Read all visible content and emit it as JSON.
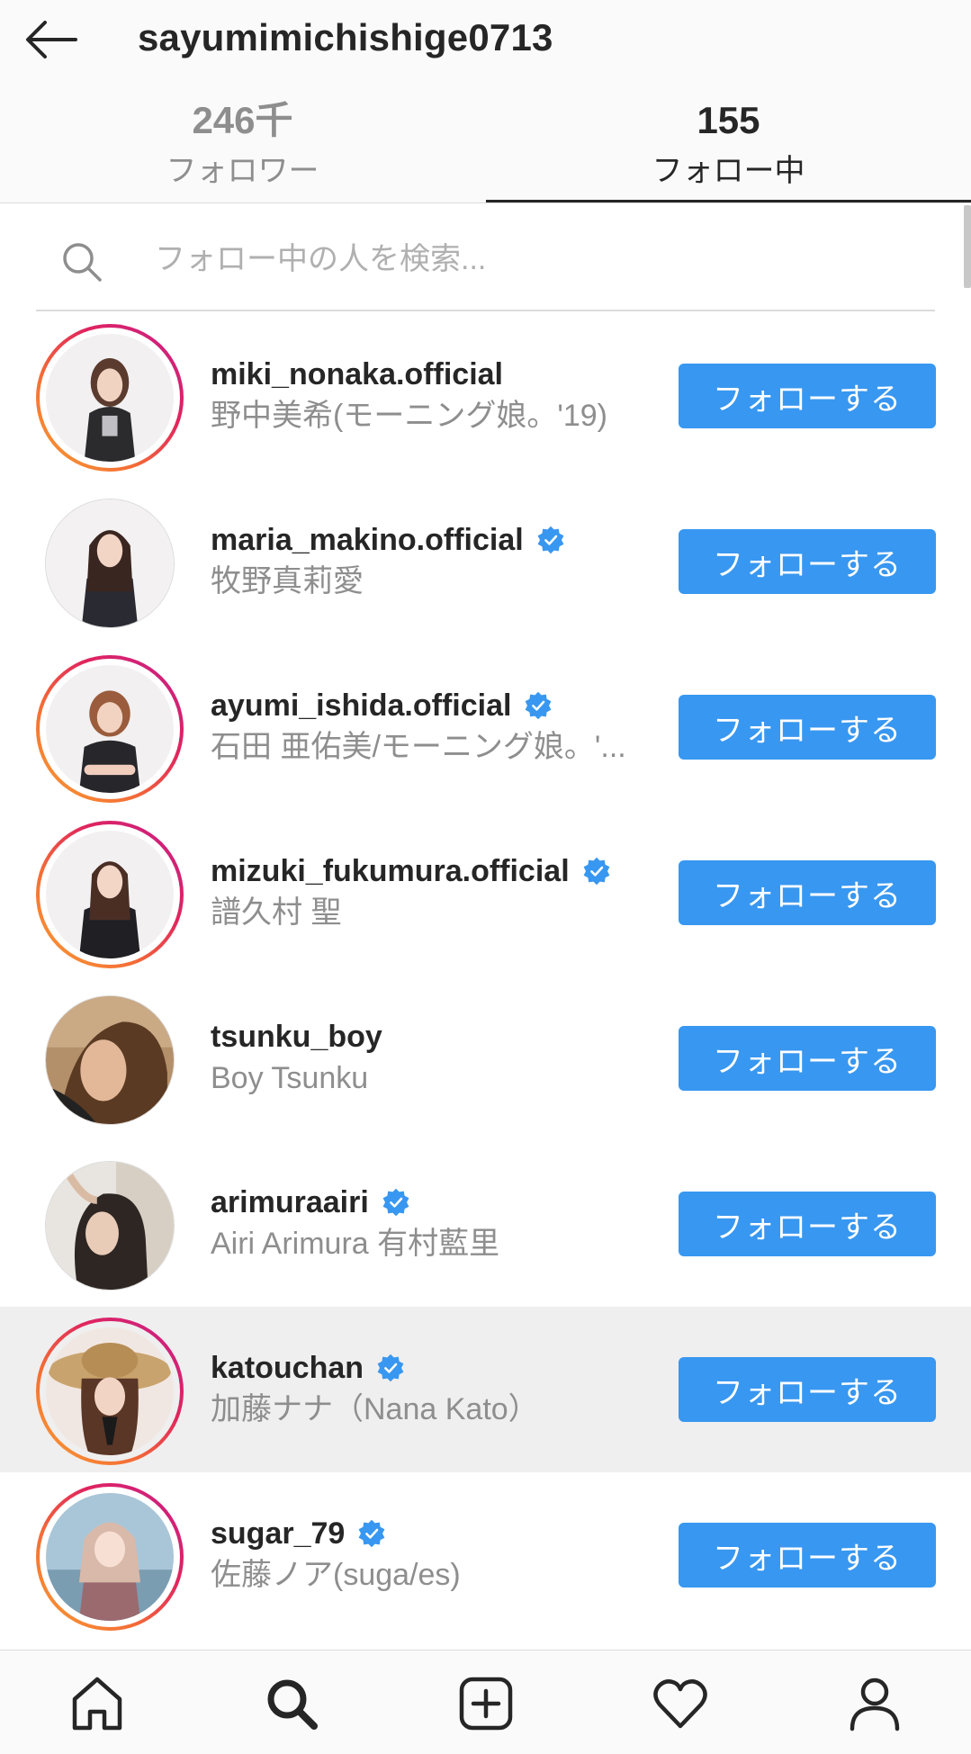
{
  "header": {
    "title": "sayumimichishige0713",
    "tabs": [
      {
        "count": "246千",
        "label": "フォロワー",
        "active": false
      },
      {
        "count": "155",
        "label": "フォロー中",
        "active": true
      }
    ]
  },
  "search": {
    "placeholder": "フォロー中の人を検索...",
    "value": ""
  },
  "accounts": [
    {
      "username": "miki_nonaka.official",
      "name": "野中美希(モーニング娘。'19)",
      "verified": false,
      "story_ring": true,
      "highlighted": false,
      "button": "フォローする"
    },
    {
      "username": "maria_makino.official",
      "name": "牧野真莉愛",
      "verified": true,
      "story_ring": false,
      "highlighted": false,
      "button": "フォローする"
    },
    {
      "username": "ayumi_ishida.official",
      "name": "石田 亜佑美/モーニング娘。'...",
      "verified": true,
      "story_ring": true,
      "highlighted": false,
      "button": "フォローする"
    },
    {
      "username": "mizuki_fukumura.official",
      "name": "譜久村 聖",
      "verified": true,
      "story_ring": true,
      "highlighted": false,
      "button": "フォローする"
    },
    {
      "username": "tsunku_boy",
      "name": "Boy Tsunku",
      "verified": false,
      "story_ring": false,
      "highlighted": false,
      "button": "フォローする"
    },
    {
      "username": "arimuraairi",
      "name": "Airi Arimura 有村藍里",
      "verified": true,
      "story_ring": false,
      "highlighted": false,
      "button": "フォローする"
    },
    {
      "username": "katouchan",
      "name": "加藤ナナ（Nana Kato）",
      "verified": true,
      "story_ring": true,
      "highlighted": true,
      "button": "フォローする"
    },
    {
      "username": "sugar_79",
      "name": "佐藤ノア(suga/es)",
      "verified": true,
      "story_ring": true,
      "highlighted": false,
      "button": "フォローする"
    }
  ],
  "bottom_nav": [
    "home-icon",
    "search-icon",
    "new-post-icon",
    "activity-heart-icon",
    "profile-icon"
  ],
  "colors": {
    "accent": "#3897f0",
    "text": "#262626",
    "muted": "#8e8e8e",
    "verified": "#3897f0"
  }
}
